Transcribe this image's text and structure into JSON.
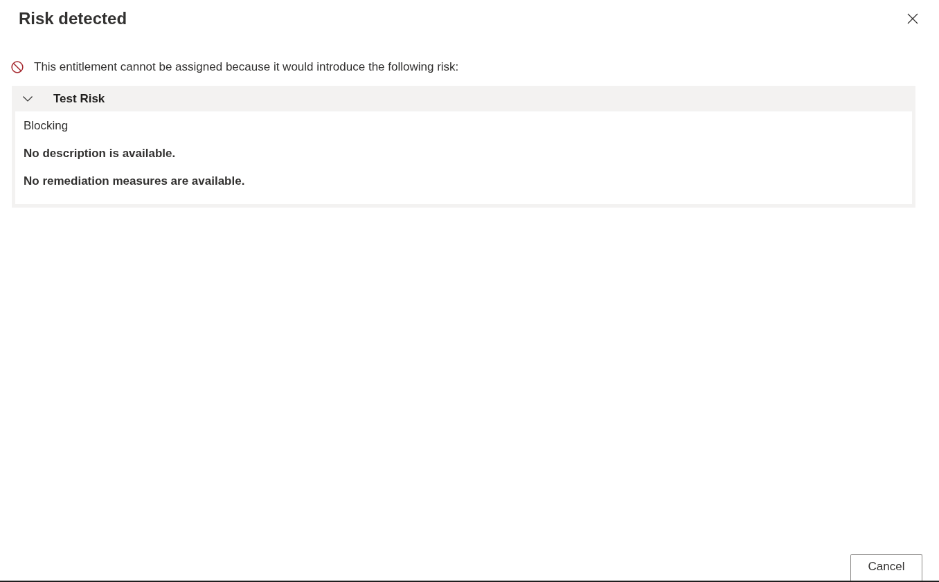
{
  "dialog": {
    "title": "Risk detected"
  },
  "message": {
    "text": "This entitlement cannot be assigned because it would introduce the following risk:"
  },
  "risks": [
    {
      "name": "Test Risk",
      "expanded": true,
      "severity": "Blocking",
      "description": "No description is available.",
      "remediation": "No remediation measures are available."
    }
  ],
  "buttons": [
    {
      "label": "Cancel"
    }
  ]
}
